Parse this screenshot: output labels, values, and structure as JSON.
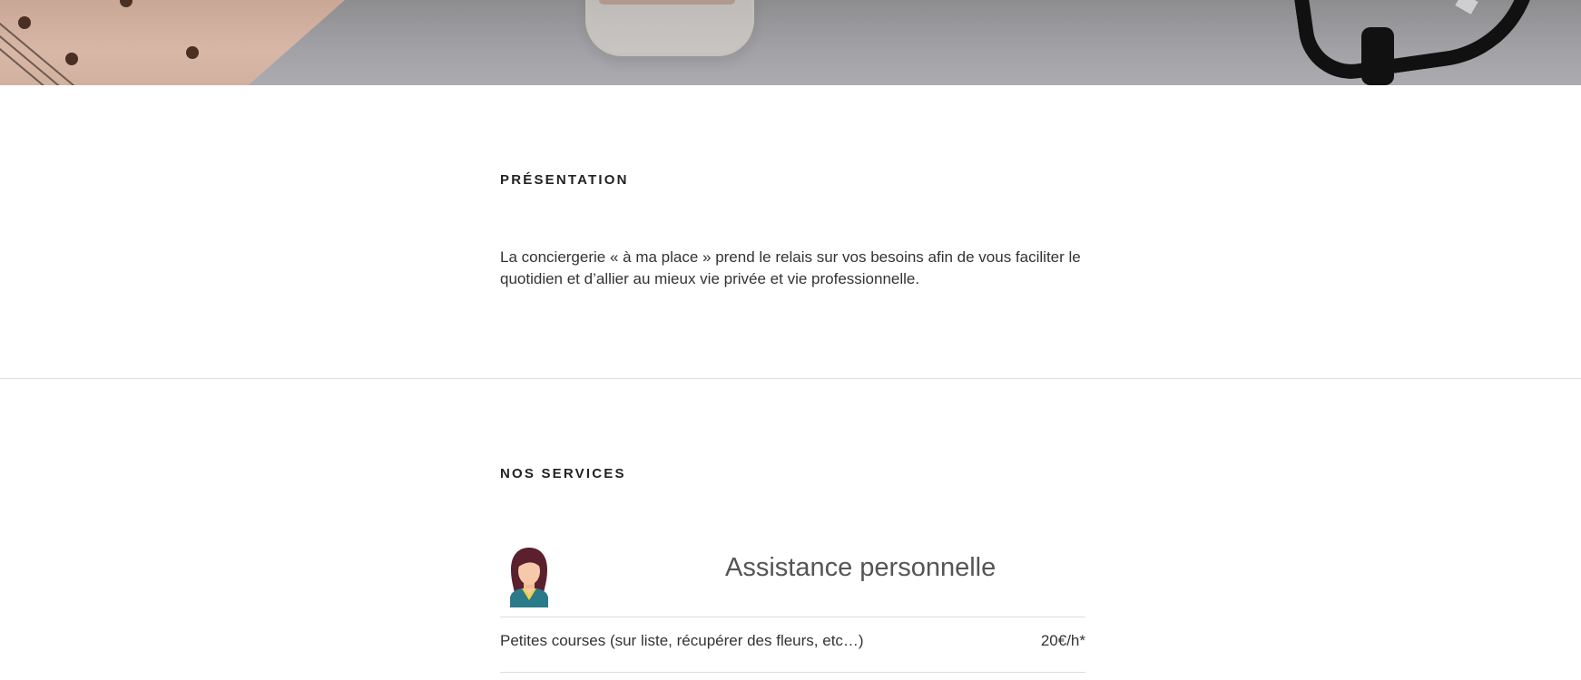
{
  "hero": {
    "image_alt": "bureau avec carnet, flacon et lunettes"
  },
  "presentation": {
    "title": "PRÉSENTATION",
    "text": "La conciergerie « à ma place » prend le relais sur vos besoins afin de vous faciliter le quotidien et d’allier au mieux vie privée et vie professionnelle."
  },
  "services": {
    "title": "NOS SERVICES",
    "categories": [
      {
        "icon": "woman-avatar-icon",
        "heading": "Assistance personnelle",
        "items": [
          {
            "label": "Petites courses (sur liste, récupérer des fleurs, etc…)",
            "price": "20€/h*"
          }
        ]
      }
    ]
  },
  "colors": {
    "heading": "#222222",
    "body_text": "#333333",
    "service_heading": "#555555",
    "divider": "#dddddd",
    "avatar_hair": "#5c1f2e",
    "avatar_skin": "#f5c9a9",
    "avatar_top": "#2b7a8a",
    "avatar_collar": "#f2d04a"
  }
}
